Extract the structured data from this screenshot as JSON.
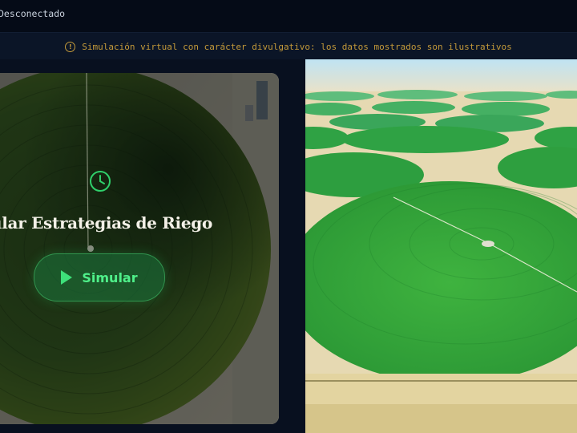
{
  "header": {
    "connection_status": "Desconectado"
  },
  "notice": {
    "text": "Simulación virtual con carácter divulgativo: los datos mostrados son ilustrativos",
    "icon": "info-circle-icon",
    "color": "#c49a3a"
  },
  "hero_card": {
    "title": "ular Estrategias de Riego",
    "icon": "clock-icon",
    "button": {
      "label": "Simular",
      "icon": "play-icon"
    },
    "accent_color": "#3ee07a"
  },
  "theme": {
    "background": "#060d1b",
    "panel": "#0b1527",
    "field_green": "#2f9e3d"
  }
}
